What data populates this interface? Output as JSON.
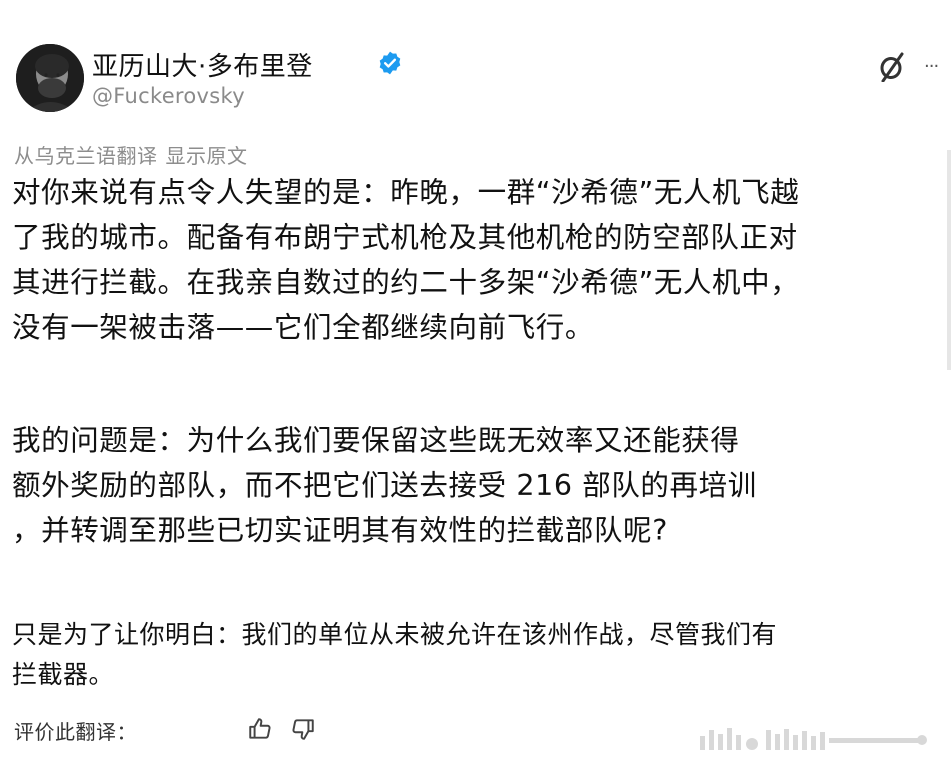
{
  "author": {
    "display_name": "亚历山大·多布里登",
    "handle": "@Fuckerovsky",
    "verified": true
  },
  "icons": {
    "avatar": "avatar-photo",
    "verified": "verified-badge-icon",
    "more": "grok-slash-icon",
    "dots": "more-dots-icon",
    "thumb_up": "thumb-up-icon",
    "thumb_down": "thumb-down-icon"
  },
  "translation": {
    "from_label": "从乌克兰语翻译",
    "show_original": "显示原文",
    "rate_label": "评价此翻译："
  },
  "tweet": {
    "paragraph_1": "对你来说有点令人失望的是：昨晚，一群“沙希德”无人机飞越\n了我的城市。配备有布朗宁式机枪及其他机枪的防空部队正对\n其进行拦截。在我亲自数过的约二十多架“沙希德”无人机中，\n没有一架被击落——它们全都继续向前飞行。",
    "paragraph_2": "我的问题是：为什么我们要保留这些既无效率又还能获得\n额外奖励的部队，而不把它们送去接受 216 部队的再培训\n，并转调至那些已切实证明其有效性的拦截部队呢?",
    "paragraph_3": "只是为了让你明白：我们的单位从未被允许在该州作战，尽管我们有\n拦截器。"
  },
  "colors": {
    "verified_blue": "#1d9bf0",
    "muted_text": "#8d8d8d",
    "body_text": "#111111",
    "background": "#ffffff"
  }
}
